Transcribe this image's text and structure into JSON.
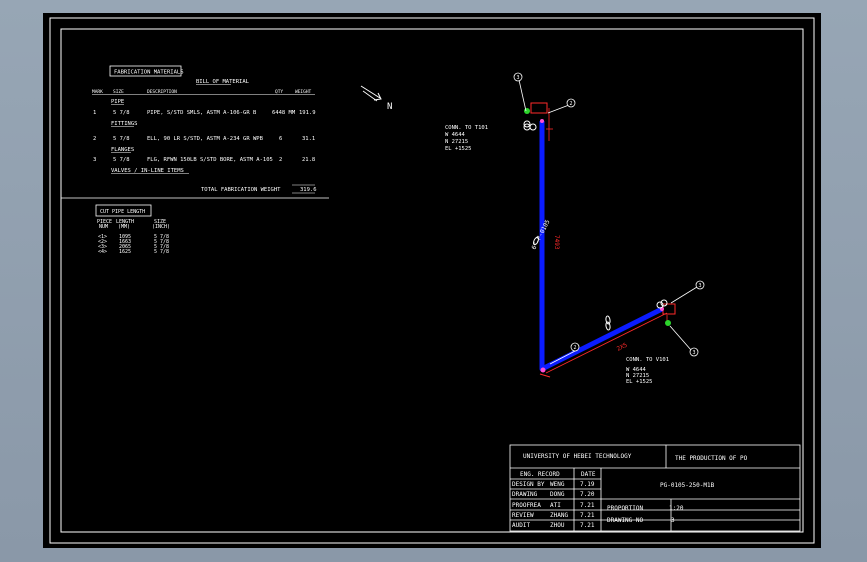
{
  "materials": {
    "heading": "FABRICATION MATERIALS",
    "bill_title": "BILL OF MATERIAL",
    "columns": [
      "MARK",
      "SIZE",
      "DESCRIPTION",
      "QTY",
      "WEIGHT"
    ],
    "groups": [
      {
        "name": "PIPE",
        "mark": "1",
        "size": "5 7/8",
        "description": "PIPE, S/STD SMLS, ASTM A-106-GR B",
        "qty": "6448 MM",
        "weight": "191.9"
      },
      {
        "name": "FITTINGS",
        "mark": "2",
        "size": "5 7/8",
        "description": "ELL, 90 LR S/STD, ASTM A-234 GR WPB",
        "qty": "6",
        "weight": "31.1"
      },
      {
        "name": "FLANGES",
        "mark": "3",
        "size": "5 7/8",
        "description": "FLG, RFWN 150LB S/STD BORE, ASTM A-105",
        "qty": "2",
        "weight": "21.8"
      }
    ],
    "valves_heading": "VALVES / IN-LINE ITEMS",
    "total_label": "TOTAL FABRICATION WEIGHT",
    "total_value": "319.6"
  },
  "cut_pipe": {
    "heading": "CUT PIPE LENGTH",
    "columns": [
      [
        "PIECE",
        "NUM"
      ],
      [
        "LENGTH",
        "(MM)"
      ],
      [
        "SIZE",
        "(INCH)"
      ]
    ],
    "rows": [
      {
        "num": "<1>",
        "length": "1095",
        "size": "5 7/8"
      },
      {
        "num": "<2>",
        "length": "1663",
        "size": "5 7/8"
      },
      {
        "num": "<3>",
        "length": "2065",
        "size": "5 7/8"
      },
      {
        "num": "<4>",
        "length": "1625",
        "size": "5 7/8"
      }
    ]
  },
  "drawing": {
    "north": "N",
    "conn_top": {
      "title": "CONN. TO T101",
      "lines": [
        "W 4644",
        "N 27215",
        "EL +1525"
      ]
    },
    "conn_bottom": {
      "title": "CONN. TO V101",
      "lines": [
        "W 4644",
        "N 27215",
        "EL +1525"
      ]
    },
    "dim_vertical": "7493",
    "dim_diagonal": "2X5",
    "pipe_tag": "6\"-P-0105",
    "balloons": [
      "3",
      "2",
      "2",
      "3",
      "3"
    ]
  },
  "title_block": {
    "university": "UNIVERSITY OF HEBEI TECHNOLOGY",
    "product": "THE PRODUCTION OF PO",
    "eng_record": "ENG. RECORD",
    "date_header": "DATE",
    "records": [
      {
        "role": "DESIGN BY",
        "name": "WENG",
        "date": "7.19"
      },
      {
        "role": "DRAWING",
        "name": "DONG",
        "date": "7.20"
      },
      {
        "role": "PROOFREA",
        "name": "ATI",
        "date": "7.21"
      },
      {
        "role": "REVIEW",
        "name": "ZHANG",
        "date": "7.21"
      },
      {
        "role": "AUDIT",
        "name": "ZHOU",
        "date": "7.21"
      }
    ],
    "drawing_number": "PG-0105-250-M1B",
    "proportion_label": "PROPORTION",
    "proportion_value": "1:20",
    "drawing_no_label": "DRAWING NO",
    "drawing_no_value": "3"
  }
}
